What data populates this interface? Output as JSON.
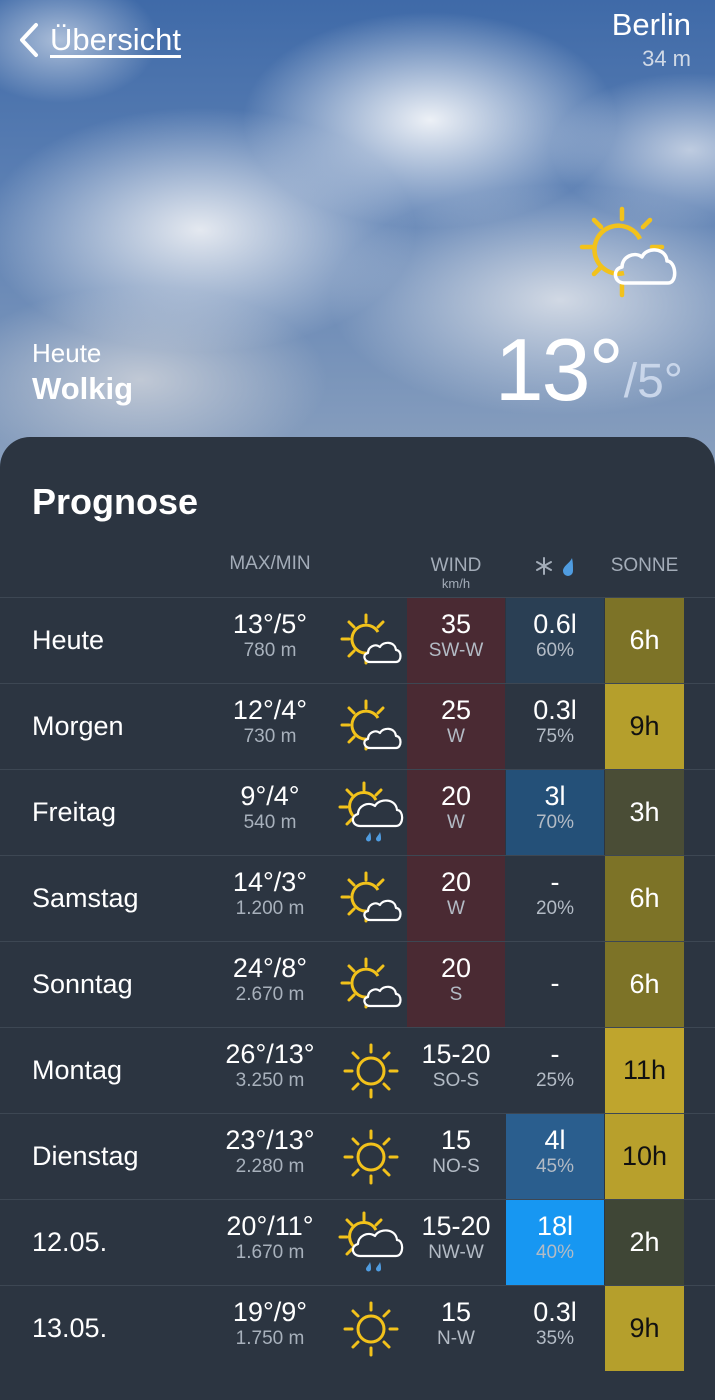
{
  "header": {
    "back_label": "Übersicht",
    "city": "Berlin",
    "elevation": "34 m"
  },
  "today": {
    "label": "Heute",
    "condition": "Wolkig",
    "temp_max": "13°",
    "temp_min": "/5°",
    "icon": "sun-cloud-icon"
  },
  "forecast": {
    "title": "Prognose",
    "headers": {
      "maxmin": "MAX/MIN",
      "wind": "WIND",
      "wind_unit": "km/h",
      "precip_icons": "snowflake-icon, raindrop-icon",
      "sun": "SONNE"
    },
    "rows": [
      {
        "day": "Heute",
        "temp": "13°/5°",
        "snowline": "780 m",
        "icon": "sun-cloud-icon",
        "wind": "35",
        "wind_dir": "SW-W",
        "precip": "0.6l",
        "precip_prob": "60%",
        "sun": "6h",
        "wind_bg": "#4a2a33",
        "precip_bg": "#2a3f54",
        "sun_bg": "#7d7327",
        "sun_fg": "#ffffff"
      },
      {
        "day": "Morgen",
        "temp": "12°/4°",
        "snowline": "730 m",
        "icon": "sun-cloud-icon",
        "wind": "25",
        "wind_dir": "W",
        "precip": "0.3l",
        "precip_prob": "75%",
        "sun": "9h",
        "wind_bg": "#4a2a33",
        "precip_bg": "",
        "sun_bg": "#b59f2c",
        "sun_fg": "#111111"
      },
      {
        "day": "Freitag",
        "temp": "9°/4°",
        "snowline": "540 m",
        "icon": "sun-cloud-rain-icon",
        "wind": "20",
        "wind_dir": "W",
        "precip": "3l",
        "precip_prob": "70%",
        "sun": "3h",
        "wind_bg": "#4a2a33",
        "precip_bg": "#245078",
        "sun_bg": "#4a4d36",
        "sun_fg": "#ffffff"
      },
      {
        "day": "Samstag",
        "temp": "14°/3°",
        "snowline": "1.200 m",
        "icon": "sun-cloud-icon",
        "wind": "20",
        "wind_dir": "W",
        "precip": "-",
        "precip_prob": "20%",
        "sun": "6h",
        "wind_bg": "#4a2a33",
        "precip_bg": "",
        "sun_bg": "#7d7327",
        "sun_fg": "#ffffff"
      },
      {
        "day": "Sonntag",
        "temp": "24°/8°",
        "snowline": "2.670 m",
        "icon": "sun-cloud-icon",
        "wind": "20",
        "wind_dir": "S",
        "precip": "-",
        "precip_prob": "",
        "sun": "6h",
        "wind_bg": "#4a2a33",
        "precip_bg": "",
        "sun_bg": "#7d7327",
        "sun_fg": "#ffffff"
      },
      {
        "day": "Montag",
        "temp": "26°/13°",
        "snowline": "3.250 m",
        "icon": "sun-icon",
        "wind": "15-20",
        "wind_dir": "SO-S",
        "precip": "-",
        "precip_prob": "25%",
        "sun": "11h",
        "wind_bg": "",
        "precip_bg": "",
        "sun_bg": "#bfa52d",
        "sun_fg": "#111111"
      },
      {
        "day": "Dienstag",
        "temp": "23°/13°",
        "snowline": "2.280 m",
        "icon": "sun-icon",
        "wind": "15",
        "wind_dir": "NO-S",
        "precip": "4l",
        "precip_prob": "45%",
        "sun": "10h",
        "wind_bg": "",
        "precip_bg": "#2a5e8e",
        "sun_bg": "#b8a02c",
        "sun_fg": "#111111"
      },
      {
        "day": "12.05.",
        "temp": "20°/11°",
        "snowline": "1.670 m",
        "icon": "sun-cloud-rain-icon",
        "wind": "15-20",
        "wind_dir": "NW-W",
        "precip": "18l",
        "precip_prob": "40%",
        "sun": "2h",
        "wind_bg": "",
        "precip_bg": "#1797f2",
        "sun_bg": "#3f4636",
        "sun_fg": "#ffffff"
      },
      {
        "day": "13.05.",
        "temp": "19°/9°",
        "snowline": "1.750 m",
        "icon": "sun-icon",
        "wind": "15",
        "wind_dir": "N-W",
        "precip": "0.3l",
        "precip_prob": "35%",
        "sun": "9h",
        "wind_bg": "",
        "precip_bg": "",
        "sun_bg": "#b59f2c",
        "sun_fg": "#111111"
      }
    ]
  }
}
